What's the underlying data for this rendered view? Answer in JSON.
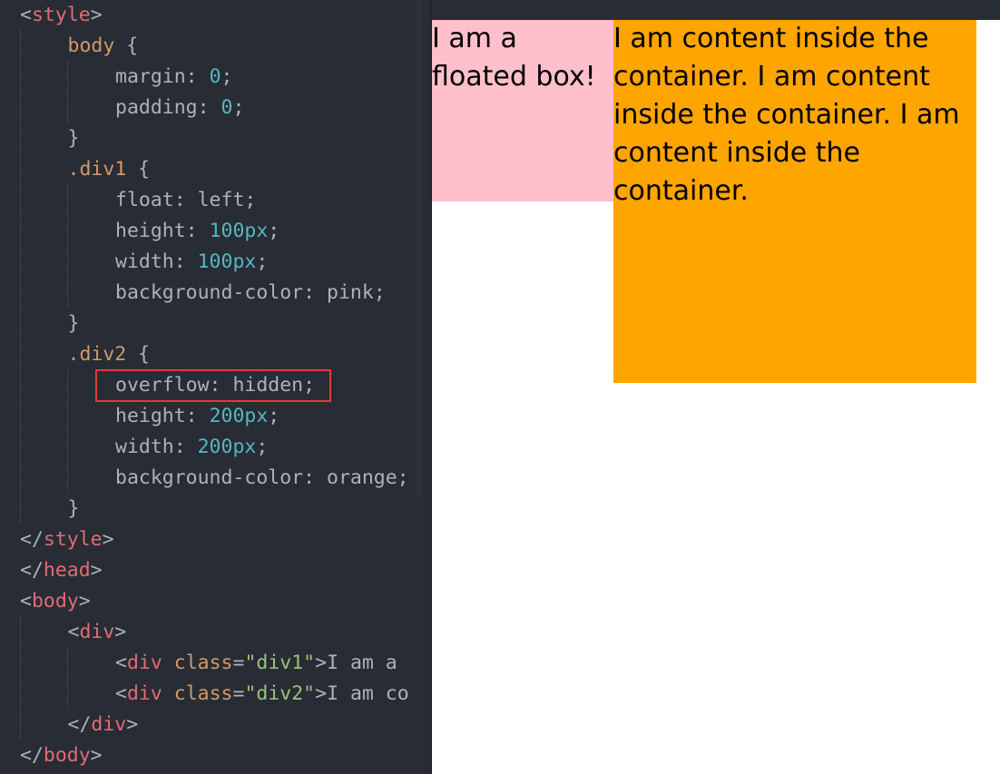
{
  "editor": {
    "lines": [
      [
        {
          "c": "punc",
          "t": "<"
        },
        {
          "c": "tag",
          "t": "style"
        },
        {
          "c": "punc",
          "t": ">"
        }
      ],
      [
        {
          "c": "sel",
          "t": "body"
        },
        {
          "c": "punc",
          "t": " {"
        }
      ],
      [
        {
          "c": "prop",
          "t": "margin: "
        },
        {
          "c": "num",
          "t": "0"
        },
        {
          "c": "punc",
          "t": ";"
        }
      ],
      [
        {
          "c": "prop",
          "t": "padding: "
        },
        {
          "c": "num",
          "t": "0"
        },
        {
          "c": "punc",
          "t": ";"
        }
      ],
      [
        {
          "c": "punc",
          "t": "}"
        }
      ],
      [
        {
          "c": "sel",
          "t": ".div1"
        },
        {
          "c": "punc",
          "t": " {"
        }
      ],
      [
        {
          "c": "prop",
          "t": "float: left;"
        }
      ],
      [
        {
          "c": "prop",
          "t": "height: "
        },
        {
          "c": "num",
          "t": "100px"
        },
        {
          "c": "punc",
          "t": ";"
        }
      ],
      [
        {
          "c": "prop",
          "t": "width: "
        },
        {
          "c": "num",
          "t": "100px"
        },
        {
          "c": "punc",
          "t": ";"
        }
      ],
      [
        {
          "c": "prop",
          "t": "background-color: pink;"
        }
      ],
      [
        {
          "c": "punc",
          "t": "}"
        }
      ],
      [
        {
          "c": "sel",
          "t": ".div2"
        },
        {
          "c": "punc",
          "t": " {"
        }
      ],
      [
        {
          "c": "prop",
          "t": "overflow: hidden;"
        }
      ],
      [
        {
          "c": "prop",
          "t": "height: "
        },
        {
          "c": "num",
          "t": "200px"
        },
        {
          "c": "punc",
          "t": ";"
        }
      ],
      [
        {
          "c": "prop",
          "t": "width: "
        },
        {
          "c": "num",
          "t": "200px"
        },
        {
          "c": "punc",
          "t": ";"
        }
      ],
      [
        {
          "c": "prop",
          "t": "background-color: orange;"
        }
      ],
      [
        {
          "c": "punc",
          "t": "}"
        }
      ],
      [
        {
          "c": "punc",
          "t": "</"
        },
        {
          "c": "tag",
          "t": "style"
        },
        {
          "c": "punc",
          "t": ">"
        }
      ],
      [
        {
          "c": "punc",
          "t": "</"
        },
        {
          "c": "tag",
          "t": "head"
        },
        {
          "c": "punc",
          "t": ">"
        }
      ],
      [
        {
          "c": "punc",
          "t": "<"
        },
        {
          "c": "tag",
          "t": "body"
        },
        {
          "c": "punc",
          "t": ">"
        }
      ],
      [
        {
          "c": "punc",
          "t": "<"
        },
        {
          "c": "tag",
          "t": "div"
        },
        {
          "c": "punc",
          "t": ">"
        }
      ],
      [
        {
          "c": "punc",
          "t": "<"
        },
        {
          "c": "tag",
          "t": "div"
        },
        {
          "c": "punc",
          "t": " "
        },
        {
          "c": "attr",
          "t": "class"
        },
        {
          "c": "punc",
          "t": "="
        },
        {
          "c": "str",
          "t": "\"div1\""
        },
        {
          "c": "punc",
          "t": ">"
        },
        {
          "c": "txt",
          "t": "I am a"
        }
      ],
      [
        {
          "c": "punc",
          "t": "<"
        },
        {
          "c": "tag",
          "t": "div"
        },
        {
          "c": "punc",
          "t": " "
        },
        {
          "c": "attr",
          "t": "class"
        },
        {
          "c": "punc",
          "t": "="
        },
        {
          "c": "str",
          "t": "\"div2\""
        },
        {
          "c": "punc",
          "t": ">"
        },
        {
          "c": "txt",
          "t": "I am co"
        }
      ],
      [
        {
          "c": "punc",
          "t": "</"
        },
        {
          "c": "tag",
          "t": "div"
        },
        {
          "c": "punc",
          "t": ">"
        }
      ],
      [
        {
          "c": "punc",
          "t": "</"
        },
        {
          "c": "tag",
          "t": "body"
        },
        {
          "c": "punc",
          "t": ">"
        }
      ]
    ],
    "colors": {
      "background": "#282c34",
      "tag": "#e06c75",
      "selector": "#d19a66",
      "number": "#56b6c2",
      "string": "#98c379",
      "text": "#abb2bf",
      "highlight_border": "#e53935"
    }
  },
  "preview": {
    "div1_lines": [
      "I am a",
      "floated box!"
    ],
    "div2_lines": [
      "I am content inside the",
      "container. I am content",
      "inside the container. I am",
      "content inside the",
      "container."
    ],
    "div1_color": "pink",
    "div2_color": "orange"
  }
}
